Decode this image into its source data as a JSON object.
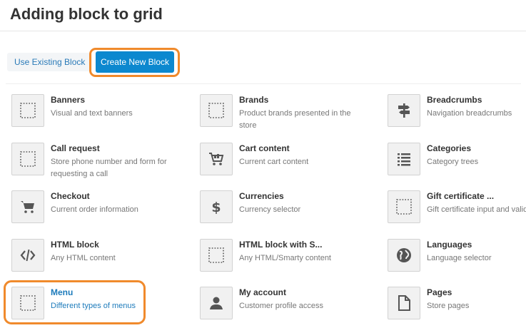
{
  "page": {
    "title": "Adding block to grid"
  },
  "tabs": {
    "existing_label": "Use Existing Block",
    "new_label": "Create New Block",
    "active": "new"
  },
  "colors": {
    "accent": "#0c88cf",
    "highlight": "#f08a2c",
    "link": "#1d7bbb"
  },
  "blocks": [
    {
      "id": "banners",
      "name": "Banners",
      "desc": "Visual and text banners",
      "icon": "dotted-square-icon",
      "selected": false
    },
    {
      "id": "brands",
      "name": "Brands",
      "desc": "Product brands presented in the store",
      "icon": "dotted-square-icon",
      "selected": false
    },
    {
      "id": "breadcrumbs",
      "name": "Breadcrumbs",
      "desc": "Navigation breadcrumbs",
      "icon": "signpost-icon",
      "selected": false
    },
    {
      "id": "call-request",
      "name": "Call request",
      "desc": "Store phone number and form for requesting a call",
      "icon": "dotted-square-icon",
      "selected": false
    },
    {
      "id": "cart-content",
      "name": "Cart content",
      "desc": "Current cart content",
      "icon": "cart-full-icon",
      "selected": false
    },
    {
      "id": "categories",
      "name": "Categories",
      "desc": "Category trees",
      "icon": "list-icon",
      "selected": false
    },
    {
      "id": "checkout",
      "name": "Checkout",
      "desc": "Current order information",
      "icon": "cart-icon",
      "selected": false
    },
    {
      "id": "currencies",
      "name": "Currencies",
      "desc": "Currency selector",
      "icon": "dollar-icon",
      "selected": false
    },
    {
      "id": "gift-certificate",
      "name": "Gift certificate ...",
      "desc": "Gift certificate input and validation",
      "icon": "dotted-square-icon",
      "selected": false
    },
    {
      "id": "html-block",
      "name": "HTML block",
      "desc": "Any HTML content",
      "icon": "code-icon",
      "selected": false
    },
    {
      "id": "html-block-smarty",
      "name": "HTML block with S...",
      "desc": "Any HTML/Smarty content",
      "icon": "dotted-square-icon",
      "selected": false
    },
    {
      "id": "languages",
      "name": "Languages",
      "desc": "Language selector",
      "icon": "globe-icon",
      "selected": false
    },
    {
      "id": "menu",
      "name": "Menu",
      "desc": "Different types of menus",
      "icon": "dotted-square-icon",
      "selected": true
    },
    {
      "id": "my-account",
      "name": "My account",
      "desc": "Customer profile access",
      "icon": "user-icon",
      "selected": false
    },
    {
      "id": "pages",
      "name": "Pages",
      "desc": "Store pages",
      "icon": "page-icon",
      "selected": false
    }
  ]
}
